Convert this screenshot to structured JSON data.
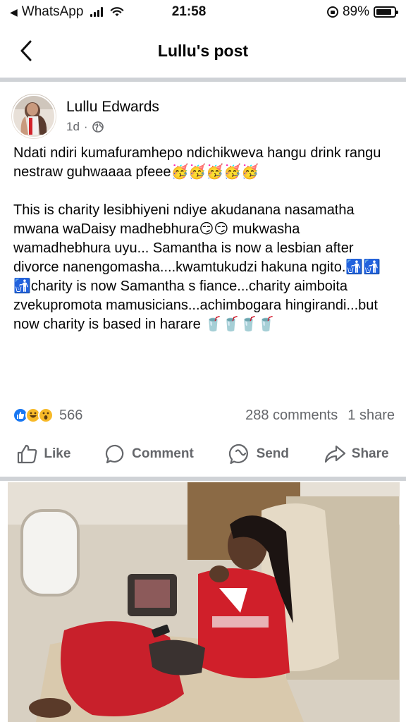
{
  "status_bar": {
    "back_app": "WhatsApp",
    "time": "21:58",
    "battery": "89%",
    "battery_level": 0.89
  },
  "header": {
    "title": "Lullu's post"
  },
  "post": {
    "author": "Lullu Edwards",
    "time": "1d",
    "separator": "·",
    "text": "Ndati ndiri kumafuramhepo ndichikweva hangu drink rangu nestraw guhwaaaa pfeee🥳🥳🥳🥳🥳\n\nThis is charity lesibhiyeni ndiye akudanana nasamatha mwana waDaisy madhebhura😏😏 mukwasha wamadhebhura uyu... Samantha is now a lesbian after divorce nanengomasha....kwamtukudzi hakuna ngito.🚮🚮🚮charity is now Samantha s fiance...charity aimboita zvekupromota mamusicians...achimbogara hingirandi...but now charity is based in harare 🥤🥤🥤🥤",
    "reaction_count": "566",
    "comments": "288 comments",
    "shares": "1 share"
  },
  "actions": {
    "like": "Like",
    "comment": "Comment",
    "send": "Send",
    "share": "Share"
  },
  "colors": {
    "like_blue": "#1877f2",
    "haha_yellow": "#f7b928",
    "divider": "#cfd2d6",
    "secondary_text": "#65676b"
  }
}
